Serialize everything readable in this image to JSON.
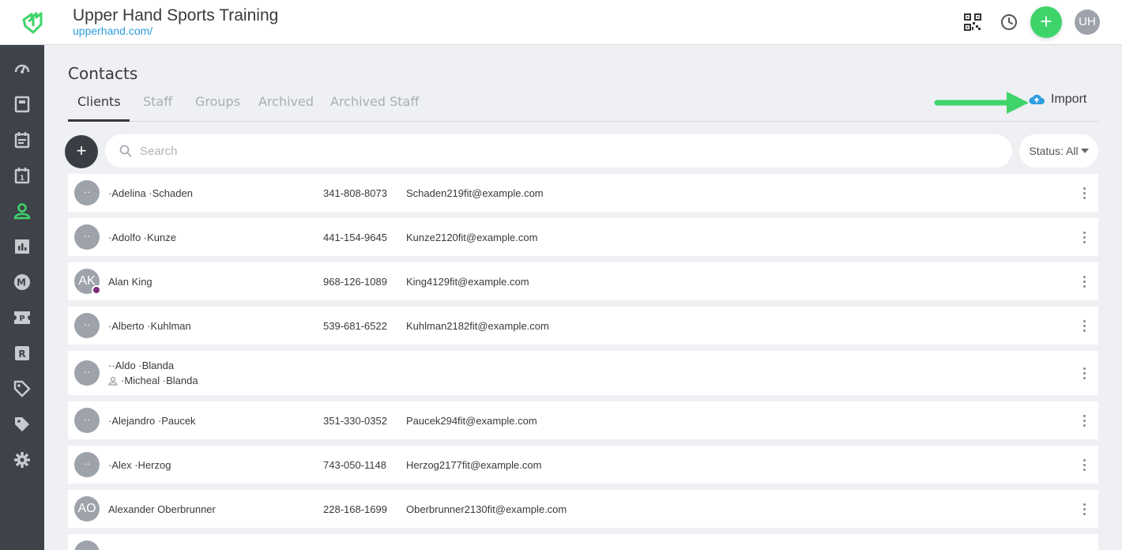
{
  "header": {
    "title": "Upper Hand Sports Training",
    "url": "upperhand.com/",
    "add_label": "+",
    "user_initials": "UH"
  },
  "sidebar": {
    "items": [
      {
        "icon": "dashboard-icon"
      },
      {
        "icon": "book-icon"
      },
      {
        "icon": "calendar-icon"
      },
      {
        "icon": "calendar-day-icon"
      },
      {
        "icon": "contacts-icon",
        "active": true
      },
      {
        "icon": "reports-icon"
      },
      {
        "icon": "memberships-icon"
      },
      {
        "icon": "passes-icon"
      },
      {
        "icon": "resources-icon"
      },
      {
        "icon": "tag-icon"
      },
      {
        "icon": "tags-icon"
      },
      {
        "icon": "settings-icon"
      }
    ]
  },
  "page": {
    "title": "Contacts",
    "tabs": [
      "Clients",
      "Staff",
      "Groups",
      "Archived",
      "Archived Staff"
    ],
    "import_label": "Import",
    "add_contact_label": "+",
    "search_placeholder": "Search",
    "status_filter": "Status: All"
  },
  "clients": [
    {
      "avatar": "··",
      "name": "·Adelina ·Schaden",
      "phone": "341-808-8073",
      "email": "Schaden219fit@example.com"
    },
    {
      "avatar": "··",
      "name": "·Adolfo ·Kunze",
      "phone": "441-154-9645",
      "email": "Kunze2120fit@example.com"
    },
    {
      "avatar": "AK",
      "name": "Alan King",
      "phone": "968-126-1089",
      "email": "King4129fit@example.com"
    },
    {
      "avatar": "··",
      "name": "·Alberto ·Kuhlman",
      "phone": "539-681-6522",
      "email": "Kuhlman2182fit@example.com"
    },
    {
      "avatar": "··",
      "name": "··Aldo ·Blanda",
      "sub_name": "·Micheal ·Blanda",
      "phone": "",
      "email": ""
    },
    {
      "avatar": "··",
      "name": "·Alejandro ·Paucek",
      "phone": "351-330-0352",
      "email": "Paucek294fit@example.com"
    },
    {
      "avatar": "··",
      "name": "·Alex ·Herzog",
      "phone": "743-050-1148",
      "email": "Herzog2177fit@example.com"
    },
    {
      "avatar": "AO",
      "name": "Alexander Oberbrunner",
      "phone": "228-168-1699",
      "email": "Oberbrunner2130fit@example.com"
    }
  ],
  "colors": {
    "accent_green": "#3fd46a",
    "link_blue": "#2f9ee0",
    "sidebar_bg": "#3e4349",
    "status_dot": "#7b2d80"
  }
}
